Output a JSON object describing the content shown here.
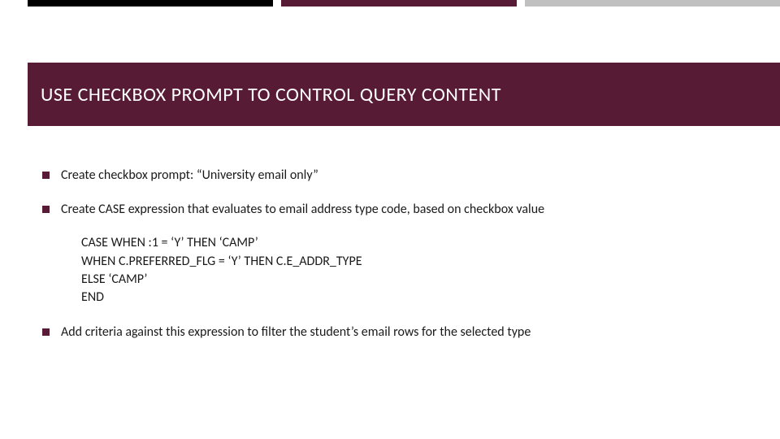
{
  "title": "USE CHECKBOX PROMPT TO CONTROL QUERY CONTENT",
  "bullets": {
    "b1": "Create checkbox prompt: “University email only”",
    "b2": "Create CASE expression that evaluates to email address type code, based on checkbox value",
    "b3": "Add criteria against this expression to filter the student’s email rows for the selected type"
  },
  "code": {
    "l1": "CASE WHEN :1 = ‘Y’ THEN ‘CAMP’",
    "l2": "WHEN C.PREFERRED_FLG = ‘Y’ THEN C.E_ADDR_TYPE",
    "l3": "ELSE ‘CAMP’",
    "l4": "END"
  }
}
